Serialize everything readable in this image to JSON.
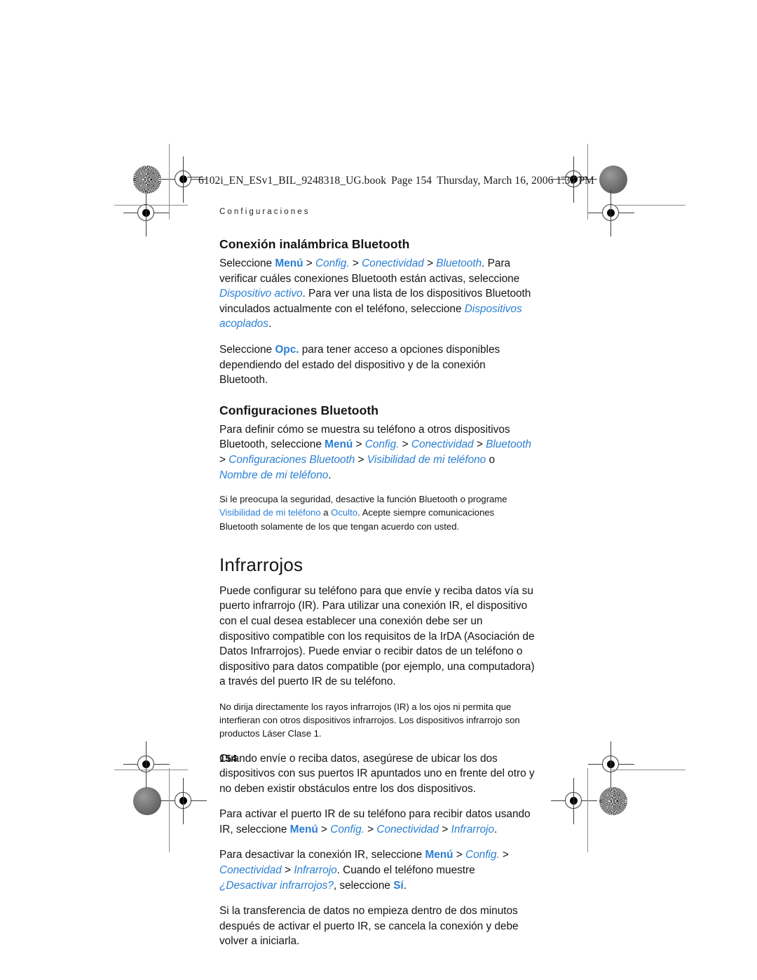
{
  "document": {
    "file_line": "6102i_EN_ESv1_BIL_9248318_UG.book",
    "page_label": "Page 154",
    "timestamp": "Thursday, March 16, 2006  1:38 PM",
    "page_number": "154",
    "running_head": "Configuraciones",
    "link_color": "#2a7fd4",
    "text_color": "#141414"
  },
  "sections": {
    "bluetooth": {
      "heading": "Conexión inalámbrica Bluetooth",
      "p1": {
        "t1": "Seleccione ",
        "l1": "Menú",
        "t2": " > ",
        "l2": "Config.",
        "t3": " > ",
        "l3": "Conectividad",
        "t4": " > ",
        "l4": "Bluetooth",
        "t5": ". Para verificar cuáles conexiones Bluetooth están activas, seleccione ",
        "l5": "Dispositivo activo",
        "t6": ". Para ver una lista de los dispositivos Bluetooth vinculados actualmente con el teléfono, seleccione ",
        "l6": "Dispositivos acoplados",
        "t7": "."
      },
      "p2": {
        "t1": "Seleccione ",
        "l1": "Opc.",
        "t2": " para tener acceso a opciones disponibles dependiendo del estado del dispositivo y de la conexión Bluetooth."
      }
    },
    "bluetooth_settings": {
      "heading": "Configuraciones Bluetooth",
      "p1": {
        "t1": "Para definir cómo se muestra su teléfono a otros dispositivos Bluetooth, seleccione ",
        "l1": "Menú",
        "t2": " > ",
        "l2": "Config.",
        "t3": " > ",
        "l3": "Conectividad",
        "t4": " > ",
        "l4": "Bluetooth",
        "t5": " > ",
        "l5": "Configuraciones Bluetooth",
        "t6": " > ",
        "l6": "Visibilidad de mi teléfono",
        "t7": " o ",
        "l7": "Nombre de mi teléfono",
        "t8": "."
      },
      "note": {
        "t1": "Si le preocupa la seguridad, desactive la función Bluetooth o programe ",
        "l1": "Visibilidad de mi teléfono",
        "t2": " a ",
        "l2": "Oculto",
        "t3": ". Acepte siempre comunicaciones Bluetooth solamente de los que tengan acuerdo con usted."
      }
    },
    "infrared": {
      "heading": "Infrarrojos",
      "p1": "Puede configurar su teléfono para que envíe y reciba datos vía su puerto infrarrojo (IR). Para utilizar una conexión IR, el dispositivo con el cual desea establecer una conexión debe ser un dispositivo compatible con los requisitos de la IrDA (Asociación de Datos Infrarrojos). Puede enviar o recibir datos de un teléfono o dispositivo para datos compatible (por ejemplo, una computadora) a través del puerto IR de su teléfono.",
      "note": "No dirija directamente los rayos infrarrojos (IR) a los ojos ni permita que interfieran con otros dispositivos infrarrojos. Los dispositivos infrarrojo son productos Láser Clase 1.",
      "p2": "Cuando envíe o reciba datos, asegúrese de ubicar los dos dispositivos con sus puertos IR apuntados uno en frente del otro y no deben existir obstáculos entre los dos dispositivos.",
      "p3": {
        "t1": "Para activar el puerto IR de su teléfono para recibir datos usando IR, seleccione ",
        "l1": "Menú",
        "t2": " > ",
        "l2": "Config.",
        "t3": " > ",
        "l3": "Conectividad",
        "t4": " > ",
        "l4": "Infrarrojo",
        "t5": "."
      },
      "p4": {
        "t1": "Para desactivar la conexión IR, seleccione ",
        "l1": "Menú",
        "t2": " > ",
        "l2": "Config.",
        "t3": " > ",
        "l3": "Conectividad",
        "t4": " > ",
        "l4": "Infrarrojo",
        "t5": ". Cuando el teléfono muestre ",
        "l5": "¿Desactivar infrarrojos?",
        "t6": ", seleccione ",
        "l6": "Sí",
        "t7": "."
      },
      "p5": "Si la transferencia de datos no empieza dentro de dos minutos después de activar el puerto IR, se cancela la conexión y debe volver a iniciarla."
    }
  }
}
